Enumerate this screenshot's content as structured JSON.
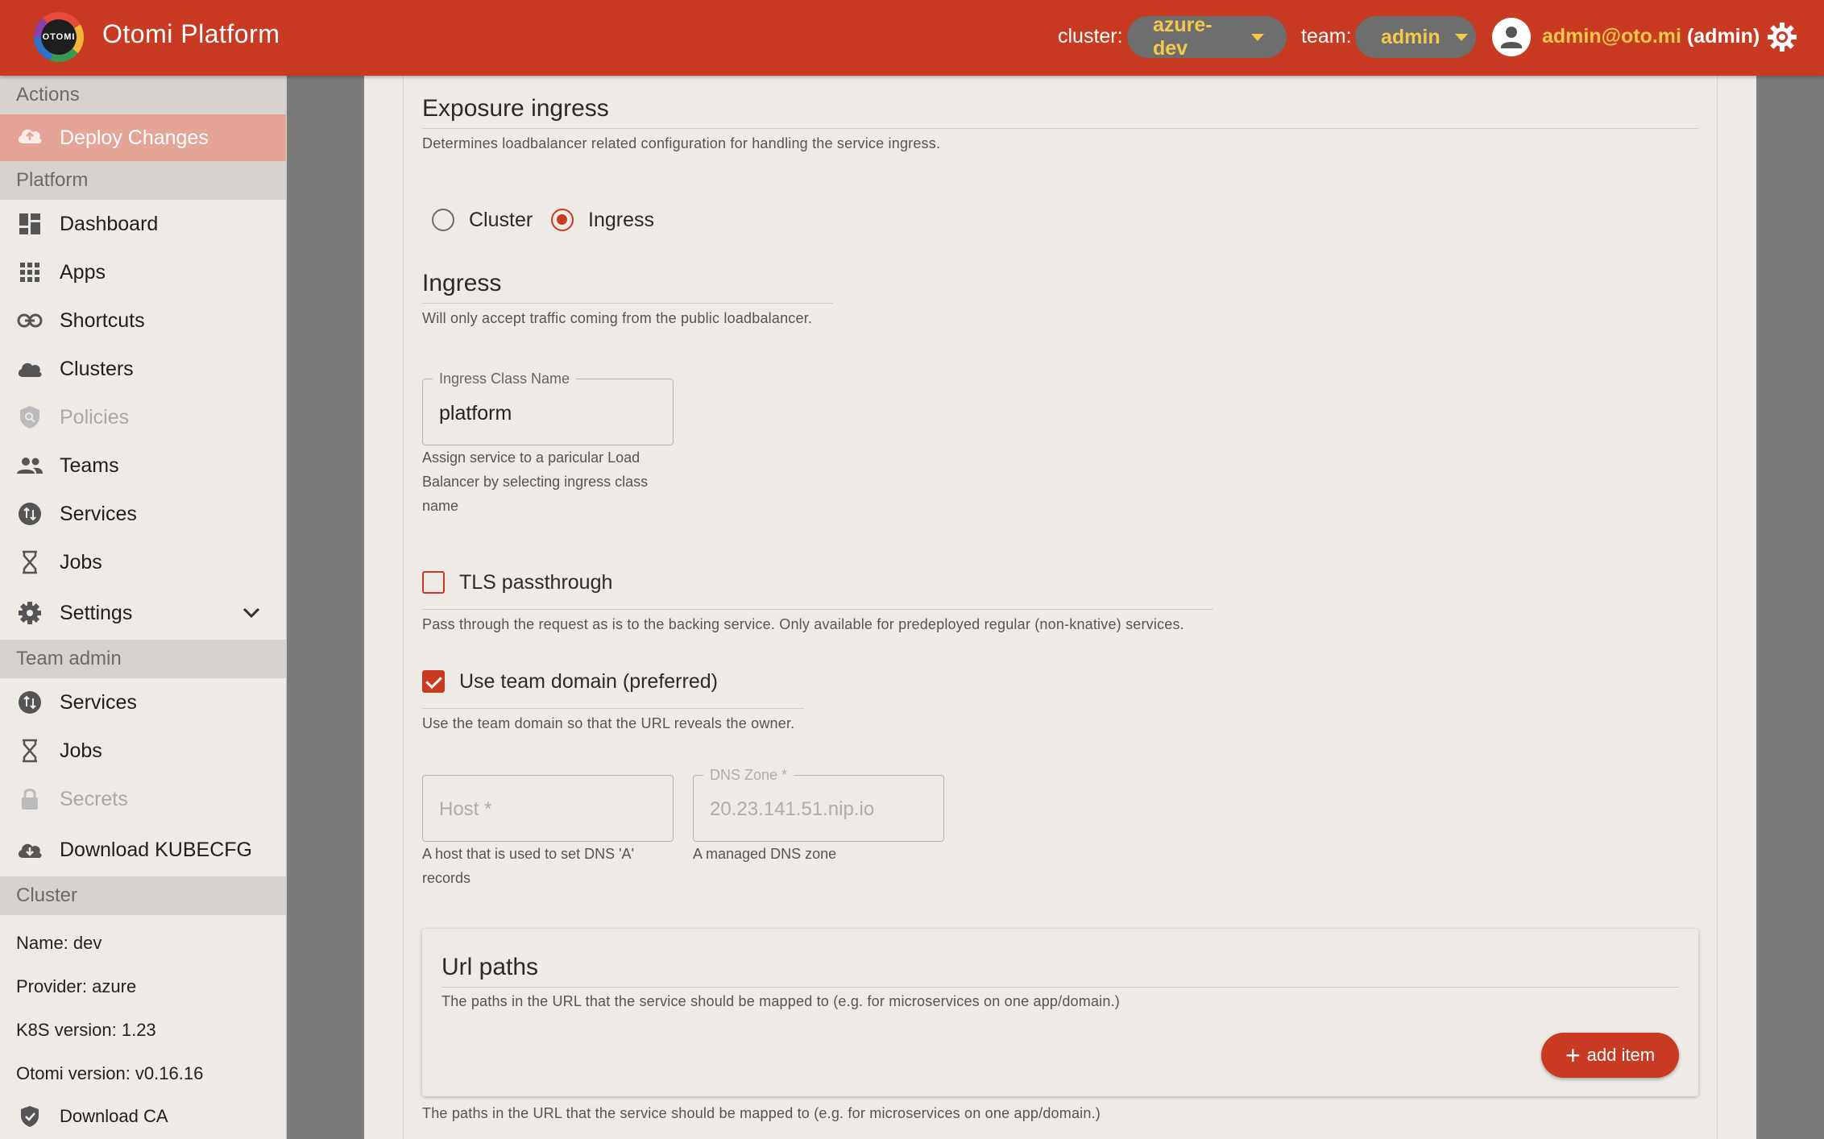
{
  "header": {
    "logo_text": "OTOMI",
    "title": "Otomi Platform",
    "cluster_label": "cluster:",
    "cluster_value": "azure-dev",
    "team_label": "team:",
    "team_value": "admin",
    "user_email": "admin@oto.mi",
    "user_role": "(admin)"
  },
  "sidebar": {
    "actions_header": "Actions",
    "deploy_label": "Deploy Changes",
    "platform_header": "Platform",
    "platform_items": [
      {
        "label": "Dashboard",
        "icon": "dashboard-icon"
      },
      {
        "label": "Apps",
        "icon": "apps-grid-icon"
      },
      {
        "label": "Shortcuts",
        "icon": "link-icon"
      },
      {
        "label": "Clusters",
        "icon": "cloud-icon"
      },
      {
        "label": "Policies",
        "icon": "policy-shield-icon"
      },
      {
        "label": "Teams",
        "icon": "people-icon"
      },
      {
        "label": "Services",
        "icon": "swap-icon"
      },
      {
        "label": "Jobs",
        "icon": "hourglass-icon"
      },
      {
        "label": "Settings",
        "icon": "gear-icon"
      }
    ],
    "team_header": "Team admin",
    "team_items": [
      {
        "label": "Services",
        "icon": "swap-icon"
      },
      {
        "label": "Jobs",
        "icon": "hourglass-icon"
      },
      {
        "label": "Secrets",
        "icon": "lock-icon"
      },
      {
        "label": "Download KUBECFG",
        "icon": "cloud-download-icon"
      }
    ],
    "cluster_header": "Cluster",
    "cluster_info": {
      "name": "Name: dev",
      "provider": "Provider: azure",
      "k8s": "K8S version: 1.23",
      "otomi": "Otomi version: v0.16.16",
      "download_ca": "Download CA"
    }
  },
  "form": {
    "exposure_title": "Exposure ingress",
    "exposure_desc": "Determines loadbalancer related configuration for handling the service ingress.",
    "radio_cluster": "Cluster",
    "radio_ingress": "Ingress",
    "selected": "Ingress",
    "ingress_title": "Ingress",
    "ingress_desc": "Will only accept traffic coming from the public loadbalancer.",
    "ingress_class_label": "Ingress Class Name",
    "ingress_class_value": "platform",
    "ingress_class_help_1": "Assign service to a paricular Load",
    "ingress_class_help_2": "Balancer by selecting ingress class",
    "ingress_class_help_3": "name",
    "tls_label": "TLS passthrough",
    "tls_checked": false,
    "tls_desc": "Pass through the request as is to the backing service. Only available for predeployed regular (non-knative) services.",
    "team_domain_label": "Use team domain (preferred)",
    "team_domain_checked": true,
    "team_domain_desc": "Use the team domain so that the URL reveals the owner.",
    "host_placeholder": "Host *",
    "host_help_1": "A host that is used to set DNS 'A'",
    "host_help_2": "records",
    "dns_label": "DNS Zone *",
    "dns_value": "20.23.141.51.nip.io",
    "dns_help": "A managed DNS zone",
    "url_paths_title": "Url paths",
    "url_paths_desc": "The paths in the URL that the service should be mapped to (e.g. for microservices on one app/domain.)",
    "add_item_label": "add item",
    "url_paths_footer": "The paths in the URL that the service should be mapped to (e.g. for microservices on one app/domain.)"
  },
  "colors": {
    "primary": "#c83a22",
    "accent": "#f4c84a",
    "sidebar_bg": "#eeeae6"
  }
}
